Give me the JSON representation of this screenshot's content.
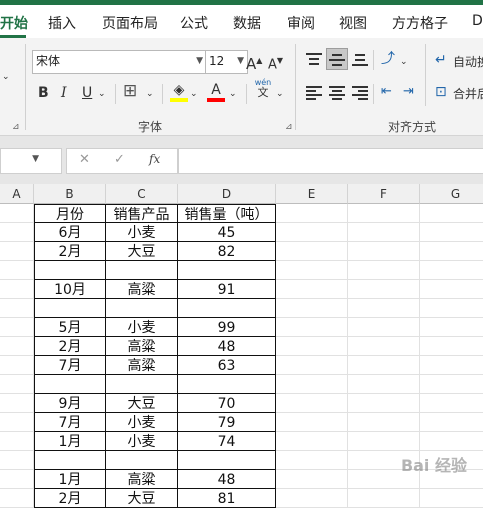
{
  "tabs": [
    "开始",
    "插入",
    "页面布局",
    "公式",
    "数据",
    "审阅",
    "视图",
    "方方格子",
    "D"
  ],
  "font": {
    "name": "宋体",
    "size": "12",
    "group_label": "字体",
    "grow": "A",
    "shrink": "A",
    "bold": "B",
    "italic": "I",
    "underline": "U",
    "font_color_letter": "A",
    "phonetic_top": "wén",
    "phonetic_bottom": "文"
  },
  "align": {
    "group_label": "对齐方式",
    "wrap_label": "自动换",
    "merge_label": "合并后"
  },
  "formula_bar": {
    "cancel": "✕",
    "enter": "✓",
    "fx": "fx",
    "value": ""
  },
  "columns": [
    "A",
    "B",
    "C",
    "D",
    "E",
    "F",
    "G"
  ],
  "table": {
    "header": [
      "月份",
      "销售产品",
      "销售量（吨）"
    ],
    "rows": [
      [
        "6月",
        "小麦",
        "45"
      ],
      [
        "2月",
        "大豆",
        "82"
      ],
      [
        "",
        "",
        ""
      ],
      [
        "10月",
        "高粱",
        "91"
      ],
      [
        "",
        "",
        ""
      ],
      [
        "5月",
        "小麦",
        "99"
      ],
      [
        "2月",
        "高粱",
        "48"
      ],
      [
        "7月",
        "高粱",
        "63"
      ],
      [
        "",
        "",
        ""
      ],
      [
        "9月",
        "大豆",
        "70"
      ],
      [
        "7月",
        "小麦",
        "79"
      ],
      [
        "1月",
        "小麦",
        "74"
      ],
      [
        "",
        "",
        ""
      ],
      [
        "1月",
        "高粱",
        "48"
      ],
      [
        "2月",
        "大豆",
        "81"
      ]
    ]
  },
  "watermark": "Bai 经验",
  "colors": {
    "accent": "#217346",
    "highlight": "#ffff00",
    "font_color": "#ff0000"
  }
}
